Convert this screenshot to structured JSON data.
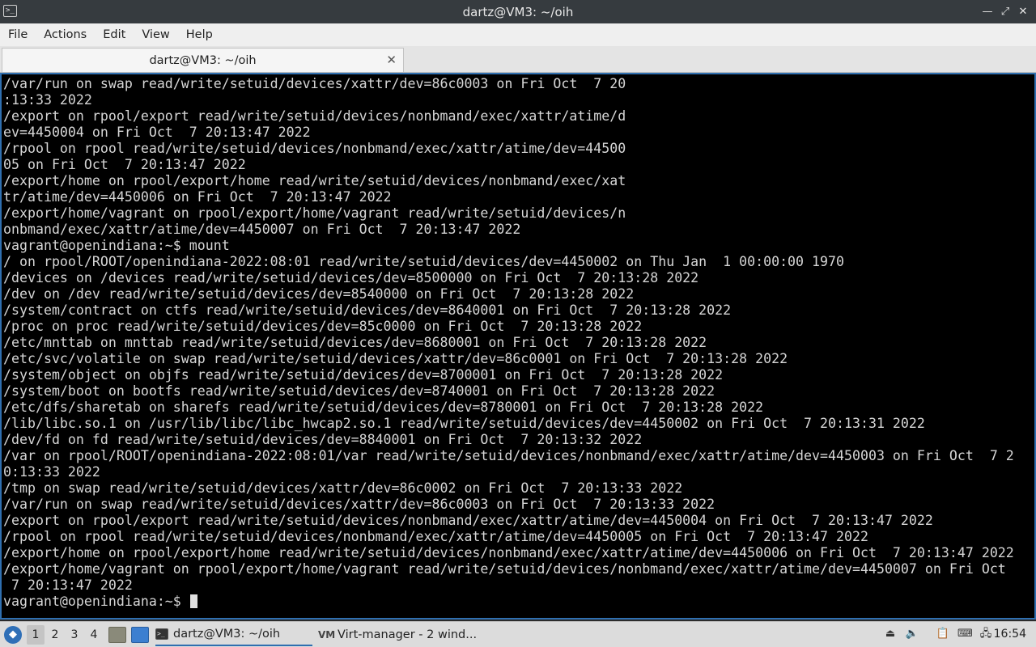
{
  "window": {
    "title": "dartz@VM3: ~/oih",
    "app_icon": "terminal-icon",
    "app_icon_glyph": ">_",
    "minimize_glyph": "—",
    "maximize_glyph": "⤢",
    "close_glyph": "✕"
  },
  "menubar": {
    "items": [
      "File",
      "Actions",
      "Edit",
      "View",
      "Help"
    ]
  },
  "tabs": [
    {
      "label": "dartz@VM3: ~/oih",
      "close_glyph": "✕"
    }
  ],
  "terminal": {
    "background": "#000000",
    "foreground": "#d6d6d6",
    "lines": [
      "/var/run on swap read/write/setuid/devices/xattr/dev=86c0003 on Fri Oct  7 20",
      ":13:33 2022",
      "/export on rpool/export read/write/setuid/devices/nonbmand/exec/xattr/atime/d",
      "ev=4450004 on Fri Oct  7 20:13:47 2022",
      "/rpool on rpool read/write/setuid/devices/nonbmand/exec/xattr/atime/dev=44500",
      "05 on Fri Oct  7 20:13:47 2022",
      "/export/home on rpool/export/home read/write/setuid/devices/nonbmand/exec/xat",
      "tr/atime/dev=4450006 on Fri Oct  7 20:13:47 2022",
      "/export/home/vagrant on rpool/export/home/vagrant read/write/setuid/devices/n",
      "onbmand/exec/xattr/atime/dev=4450007 on Fri Oct  7 20:13:47 2022",
      "vagrant@openindiana:~$ mount",
      "/ on rpool/ROOT/openindiana-2022:08:01 read/write/setuid/devices/dev=4450002 on Thu Jan  1 00:00:00 1970",
      "/devices on /devices read/write/setuid/devices/dev=8500000 on Fri Oct  7 20:13:28 2022",
      "/dev on /dev read/write/setuid/devices/dev=8540000 on Fri Oct  7 20:13:28 2022",
      "/system/contract on ctfs read/write/setuid/devices/dev=8640001 on Fri Oct  7 20:13:28 2022",
      "/proc on proc read/write/setuid/devices/dev=85c0000 on Fri Oct  7 20:13:28 2022",
      "/etc/mnttab on mnttab read/write/setuid/devices/dev=8680001 on Fri Oct  7 20:13:28 2022",
      "/etc/svc/volatile on swap read/write/setuid/devices/xattr/dev=86c0001 on Fri Oct  7 20:13:28 2022",
      "/system/object on objfs read/write/setuid/devices/dev=8700001 on Fri Oct  7 20:13:28 2022",
      "/system/boot on bootfs read/write/setuid/devices/dev=8740001 on Fri Oct  7 20:13:28 2022",
      "/etc/dfs/sharetab on sharefs read/write/setuid/devices/dev=8780001 on Fri Oct  7 20:13:28 2022",
      "/lib/libc.so.1 on /usr/lib/libc/libc_hwcap2.so.1 read/write/setuid/devices/dev=4450002 on Fri Oct  7 20:13:31 2022",
      "/dev/fd on fd read/write/setuid/devices/dev=8840001 on Fri Oct  7 20:13:32 2022",
      "/var on rpool/ROOT/openindiana-2022:08:01/var read/write/setuid/devices/nonbmand/exec/xattr/atime/dev=4450003 on Fri Oct  7 2",
      "0:13:33 2022",
      "/tmp on swap read/write/setuid/devices/xattr/dev=86c0002 on Fri Oct  7 20:13:33 2022",
      "/var/run on swap read/write/setuid/devices/xattr/dev=86c0003 on Fri Oct  7 20:13:33 2022",
      "/export on rpool/export read/write/setuid/devices/nonbmand/exec/xattr/atime/dev=4450004 on Fri Oct  7 20:13:47 2022",
      "/rpool on rpool read/write/setuid/devices/nonbmand/exec/xattr/atime/dev=4450005 on Fri Oct  7 20:13:47 2022",
      "/export/home on rpool/export/home read/write/setuid/devices/nonbmand/exec/xattr/atime/dev=4450006 on Fri Oct  7 20:13:47 2022",
      "/export/home/vagrant on rpool/export/home/vagrant read/write/setuid/devices/nonbmand/exec/xattr/atime/dev=4450007 on Fri Oct",
      " 7 20:13:47 2022"
    ],
    "prompt": "vagrant@openindiana:~$ "
  },
  "taskbar": {
    "start_icon": "start-menu-icon",
    "workspaces": [
      "1",
      "2",
      "3",
      "4"
    ],
    "active_workspace": "1",
    "launchers": [
      "file-manager-icon",
      "show-desktop-icon"
    ],
    "tasks": [
      {
        "label": "dartz@VM3: ~/oih",
        "icon": "terminal-icon",
        "active": true
      },
      {
        "label": "Virt-manager - 2 wind...",
        "icon": "virt-manager-icon",
        "active": false
      }
    ],
    "tray": [
      "eject-icon",
      "volume-icon",
      "clipboard-icon",
      "keyboard-icon",
      "network-icon"
    ],
    "clock": "16:54",
    "accent": "#2f6fb0"
  }
}
